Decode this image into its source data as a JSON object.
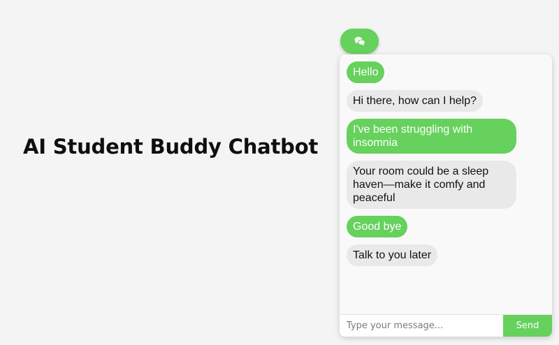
{
  "page": {
    "title": "AI Student Buddy Chatbot"
  },
  "chat_toggle": {
    "icon": "chat-bubbles-icon"
  },
  "chat": {
    "messages": [
      {
        "role": "user",
        "text": "Hello"
      },
      {
        "role": "bot",
        "text": "Hi there, how can I help?"
      },
      {
        "role": "user",
        "text": "I've been struggling with insomnia"
      },
      {
        "role": "bot",
        "text": "Your room could be a sleep haven—make it comfy and peaceful"
      },
      {
        "role": "user",
        "text": "Good bye"
      },
      {
        "role": "bot",
        "text": "Talk to you later"
      }
    ],
    "input_placeholder": "Type your message...",
    "send_label": "Send"
  },
  "colors": {
    "accent": "#66d15c",
    "bot_bubble": "#e9e9e9",
    "background": "#f4f4f4"
  }
}
